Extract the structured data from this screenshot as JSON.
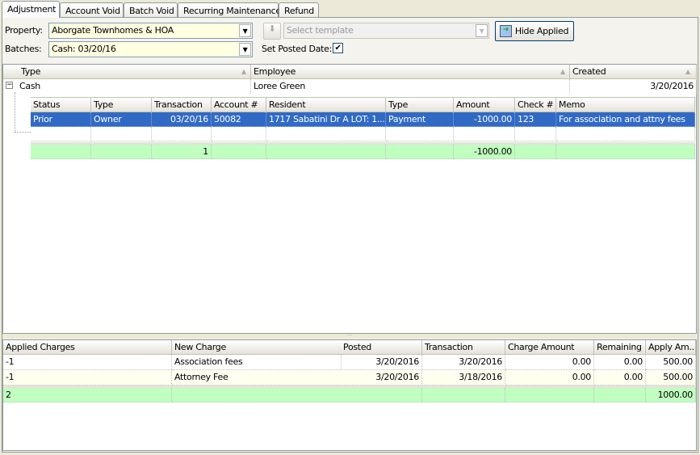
{
  "tabs": [
    {
      "label": "Adjustment",
      "active": true
    },
    {
      "label": "Account Void"
    },
    {
      "label": "Batch Void"
    },
    {
      "label": "Recurring Maintenance"
    },
    {
      "label": "Refund"
    }
  ],
  "filters": {
    "property_label": "Property:",
    "property_value": "Aborgate Townhomes & HOA",
    "batches_label": "Batches:",
    "batches_value": "Cash: 03/20/16",
    "template_placeholder": "Select template",
    "set_posted_date_label": "Set Posted Date:",
    "set_posted_date_checked": true,
    "hide_applied_label": "Hide Applied"
  },
  "top_grid": {
    "columns": [
      "Type",
      "Employee",
      "Created"
    ],
    "group_row": {
      "type": "Cash",
      "employee": "Loree Green",
      "created": "3/20/2016"
    },
    "detail": {
      "columns": [
        "Status",
        "Type",
        "Transaction",
        "Account #",
        "Resident",
        "Type",
        "Amount",
        "Check #",
        "Memo"
      ],
      "rows": [
        [
          "Prior",
          "Owner",
          "03/20/16",
          "50082",
          "1717 Sabatini Dr A  LOT: 1...",
          "Payment",
          "-1000.00",
          "123",
          "For association and attny fees"
        ]
      ],
      "summary": [
        "",
        "",
        "1",
        "",
        "",
        "",
        "-1000.00",
        "",
        ""
      ]
    }
  },
  "bottom_grid": {
    "columns": [
      "Applied Charges",
      "New Charge",
      "Posted",
      "Transaction",
      "Charge Amount",
      "Remaining",
      "Apply  Am..."
    ],
    "rows": [
      [
        "-1",
        "Association fees",
        "3/20/2016",
        "3/20/2016",
        "0.00",
        "0.00",
        "500.00"
      ],
      [
        "-1",
        "Attorney Fee",
        "3/20/2016",
        "3/18/2016",
        "0.00",
        "0.00",
        "500.00"
      ]
    ],
    "summary": [
      "2",
      "",
      "",
      "",
      "",
      "",
      "1000.00"
    ]
  },
  "colors": {
    "selection": "#316ac5",
    "summary": "#c0ffc0",
    "input_bg": "#ffffe1"
  }
}
